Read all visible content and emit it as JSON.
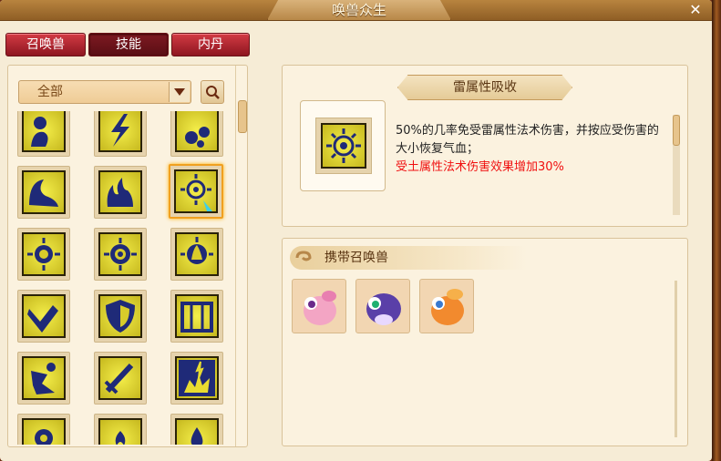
{
  "window": {
    "title": "唤兽众生",
    "close_icon": "close-icon"
  },
  "tabs": [
    {
      "label": "召唤兽",
      "active": false
    },
    {
      "label": "技能",
      "active": true
    },
    {
      "label": "内丹",
      "active": false
    }
  ],
  "filter": {
    "selected": "全部",
    "dropdown_icon": "chevron-down-icon",
    "search_icon": "search-icon"
  },
  "skills": {
    "icons": [
      "stone-figure-icon",
      "lightning-icon",
      "meteor-icon",
      "water-wave-icon",
      "flame-icon",
      "thunder-absorb-icon",
      "sun-emblem-icon",
      "sun-gear-icon",
      "sun-fire-icon",
      "broken-arm-icon",
      "shield-icon",
      "gate-icon",
      "kick-icon",
      "sword-icon",
      "explosion-icon",
      "bomb-icon",
      "plant-icon",
      "fire-drop-icon"
    ],
    "selected": "thunder-absorb-icon"
  },
  "detail": {
    "title": "雷属性吸收",
    "description": "50%的几率免受雷属性法术伤害，并按应受伤害的大小恢复气血；",
    "effect_red": "受土属性法术伤害效果增加30%",
    "accent_red": "#f01010"
  },
  "pets": {
    "header": "携带召唤兽",
    "items": [
      {
        "name": "pink-pet-avatar",
        "color": "#f3a5c4"
      },
      {
        "name": "purple-pet-avatar",
        "color": "#5a3fa8"
      },
      {
        "name": "orange-pet-avatar",
        "color": "#f28a2e"
      }
    ]
  }
}
